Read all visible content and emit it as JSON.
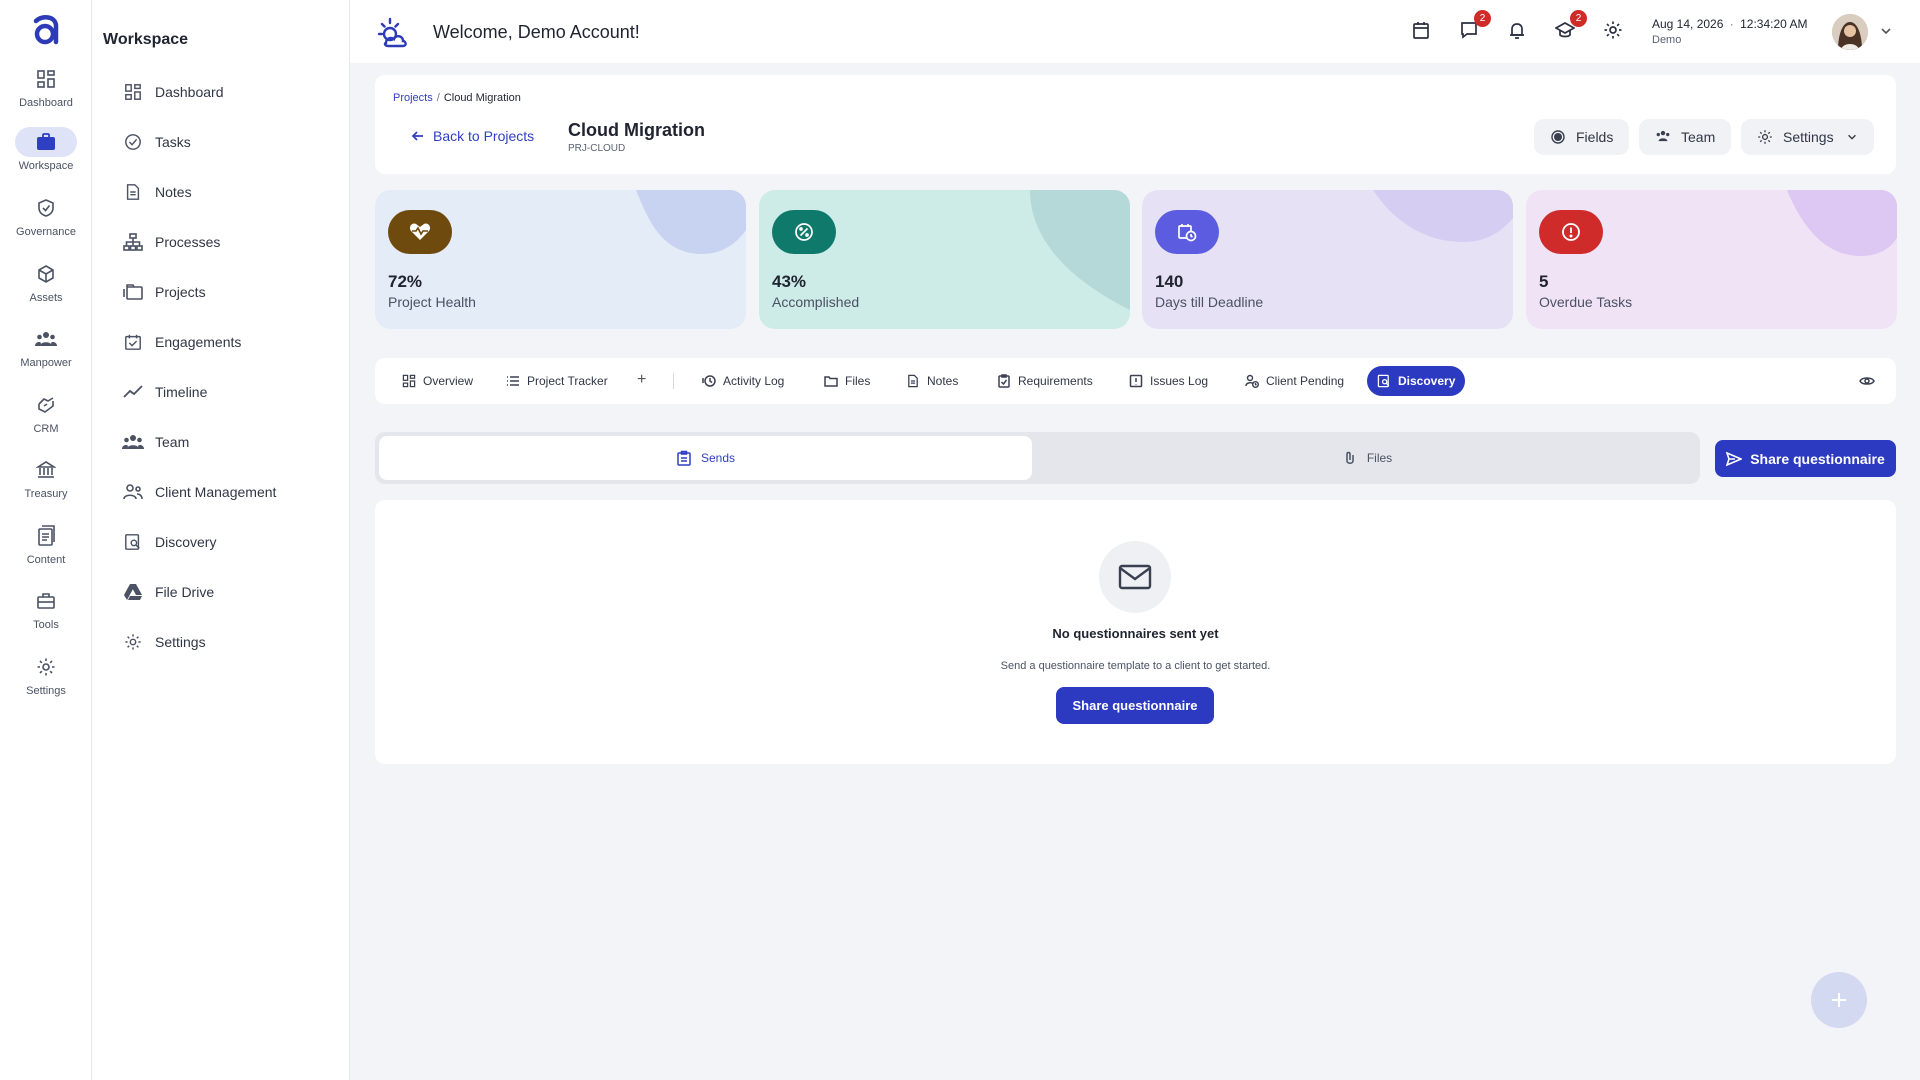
{
  "rail": {
    "items": [
      {
        "label": "Dashboard",
        "icon": "dashboard-grid-icon"
      },
      {
        "label": "Workspace",
        "icon": "briefcase-icon",
        "active": true
      },
      {
        "label": "Governance",
        "icon": "shield-check-icon"
      },
      {
        "label": "Assets",
        "icon": "cube-icon"
      },
      {
        "label": "Manpower",
        "icon": "people-icon"
      },
      {
        "label": "CRM",
        "icon": "handshake-icon"
      },
      {
        "label": "Treasury",
        "icon": "bank-icon"
      },
      {
        "label": "Content",
        "icon": "document-icon"
      },
      {
        "label": "Tools",
        "icon": "toolbox-icon"
      },
      {
        "label": "Settings",
        "icon": "gear-icon"
      }
    ]
  },
  "sidebar": {
    "title": "Workspace",
    "items": [
      {
        "label": "Dashboard",
        "icon": "dashboard-grid-icon"
      },
      {
        "label": "Tasks",
        "icon": "check-circle-icon"
      },
      {
        "label": "Notes",
        "icon": "note-icon"
      },
      {
        "label": "Processes",
        "icon": "hierarchy-icon"
      },
      {
        "label": "Projects",
        "icon": "folders-icon"
      },
      {
        "label": "Engagements",
        "icon": "calendar-check-icon"
      },
      {
        "label": "Timeline",
        "icon": "trend-line-icon"
      },
      {
        "label": "Team",
        "icon": "team-icon"
      },
      {
        "label": "Client Management",
        "icon": "client-icon"
      },
      {
        "label": "Discovery",
        "icon": "search-document-icon"
      },
      {
        "label": "File Drive",
        "icon": "drive-icon"
      },
      {
        "label": "Settings",
        "icon": "gear-icon"
      }
    ]
  },
  "header": {
    "welcome": "Welcome, Demo Account!",
    "messages_badge": "2",
    "academy_badge": "2",
    "date": "Aug 14, 2026",
    "time": "12:34:20 AM",
    "user": "Demo"
  },
  "project": {
    "breadcrumb_root": "Projects",
    "breadcrumb_sep": "/",
    "breadcrumb_current": "Cloud Migration",
    "back_label": "Back to Projects",
    "title": "Cloud Migration",
    "code": "PRJ-CLOUD",
    "buttons": {
      "fields": "Fields",
      "team": "Team",
      "settings": "Settings"
    }
  },
  "stats": [
    {
      "value": "72%",
      "label": "Project Health",
      "icon": "heart-pulse-icon",
      "bg": "#e3ecf7",
      "icon_bg": "#6f4a0e",
      "blob": "#c7d3f1"
    },
    {
      "value": "43%",
      "label": "Accomplished",
      "icon": "percent-badge-icon",
      "bg": "#cdebe7",
      "icon_bg": "#0f7a6c",
      "blob": "#b4d9d8"
    },
    {
      "value": "140",
      "label": "Days till Deadline",
      "icon": "calendar-clock-icon",
      "bg": "#e7e1f6",
      "icon_bg": "#5b5ce0",
      "blob": "#d6cdf3"
    },
    {
      "value": "5",
      "label": "Overdue Tasks",
      "icon": "alert-circle-icon",
      "bg": "#f1e3f6",
      "icon_bg": "#cf2b2b",
      "blob": "#dcc8f3"
    }
  ],
  "tabs": {
    "items": [
      {
        "label": "Overview"
      },
      {
        "label": "Project Tracker"
      },
      {
        "label": "Activity Log"
      },
      {
        "label": "Files"
      },
      {
        "label": "Notes"
      },
      {
        "label": "Requirements"
      },
      {
        "label": "Issues Log"
      },
      {
        "label": "Client Pending"
      },
      {
        "label": "Discovery",
        "active": true
      }
    ],
    "plus": "+"
  },
  "discovery": {
    "segment_sends": "Sends",
    "segment_files": "Files",
    "share_button": "Share questionnaire",
    "empty_title": "No questionnaires sent yet",
    "empty_subtitle": "Send a questionnaire template to a client to get started.",
    "empty_button": "Share questionnaire"
  },
  "colors": {
    "accent": "#2c3ac2",
    "link": "#2f3fc4",
    "badge": "#cf2b2b"
  }
}
